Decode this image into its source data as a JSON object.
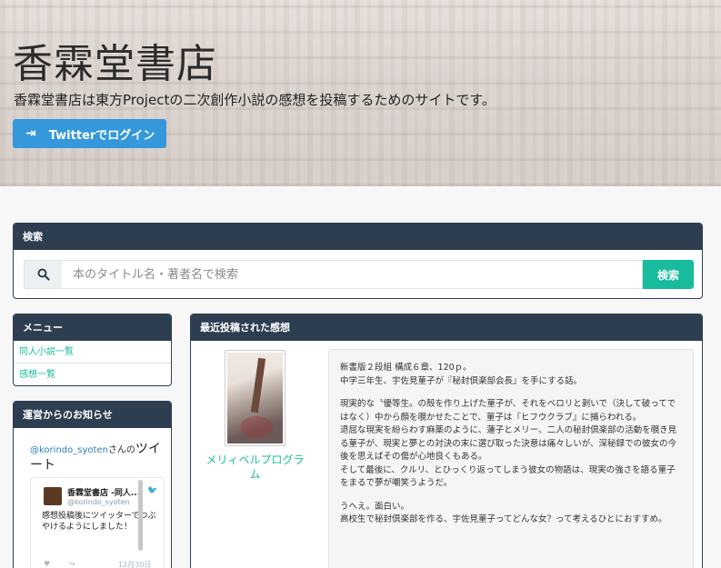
{
  "hero": {
    "title": "香霖堂書店",
    "description": "香霖堂書店は東方Projectの二次創作小説の感想を投稿するためのサイトです。",
    "login_label": "Twitterでログイン",
    "login_icon": "sign-in-icon"
  },
  "search": {
    "heading": "検索",
    "placeholder": "本のタイトル名・著者名で検索",
    "button_label": "検索",
    "icon": "search-icon"
  },
  "menu": {
    "heading": "メニュー",
    "items": [
      {
        "label": "同人小説一覧"
      },
      {
        "label": "感想一覧"
      }
    ]
  },
  "notices": {
    "heading": "運営からのお知らせ",
    "timeline": {
      "handle": "@korindo_syoten",
      "handle_suffix": "さんの",
      "title": "ツイート"
    },
    "tweet": {
      "name": "香霖堂書店 -同人...",
      "screen_name": "@korindo_syoten",
      "text": "感想投稿後にツイッターでつぶやけるようにしました！",
      "date": "12月30日"
    }
  },
  "recent": {
    "heading": "最近投稿された感想",
    "book_title": "メリィベルプログラム",
    "review_paragraphs": [
      [
        "新書版２段組 構成６章、120ｐ。",
        "中学三年生、宇佐見菫子が『秘封倶楽部会長』を手にする話。"
      ],
      [
        "現実的な〝優等生。の殻を作り上げた菫子が、それをベロリと剥いで（決して破ってではなく）中から顔を覗かせたことで、菫子は『ヒフウクラブ』に捕らわれる。",
        "退屈な現実を紛らわす麻薬のように、蓮子とメリー、二人の秘封倶楽部の活動を覗き見る菫子が、現実と夢との対決の末に選び取った決意は痛々しいが、深秘録での彼女の今後を思えばその傷が心地良くもある。",
        "そして最後に、クルリ、とひっくり返ってしまう彼女の物語は、現実の強さを語る菫子をまるで夢が嘲笑うようだ。"
      ],
      [
        "うへえ。面白い。",
        "高校生で秘封倶楽部を作る、宇佐見菫子ってどんな女？って考えるひとにおすすめ。"
      ]
    ]
  },
  "colors": {
    "navy": "#2c3e50",
    "green": "#18bc9c",
    "blue": "#3498db"
  }
}
